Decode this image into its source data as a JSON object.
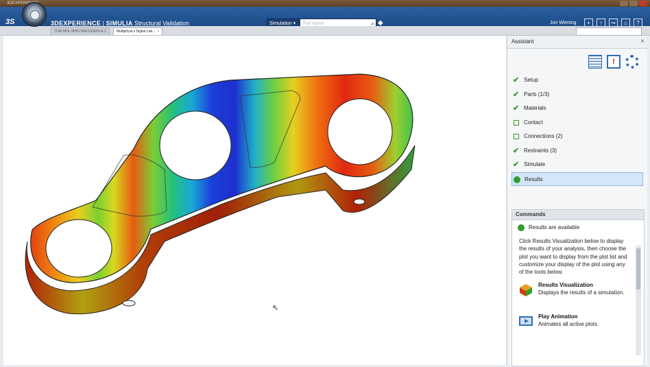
{
  "os": {
    "title": "3DEXPERIENCE"
  },
  "header": {
    "brand": "3DEXPERIENCE",
    "separator": " | ",
    "app_name": "SIMULIA",
    "app_sub": " Structural Validation",
    "search_scope": "Simulation ▾",
    "search_placeholder": "Full name",
    "search_icon": "⌕",
    "tag_icon": "◆",
    "user": "Jon Wiening",
    "buttons": [
      "+",
      "↑",
      "↪",
      "⌂",
      "?"
    ]
  },
  "tabs": [
    {
      "label": "TDIP-MHL-MHO-SIM-SSSRH-A.1"
    },
    {
      "label": "Multiphysics Digital Lab...",
      "close": "×"
    }
  ],
  "viewport": {
    "cursor": "⇖"
  },
  "assistant": {
    "title": "Assistant",
    "close": "×",
    "tool_alert": "!",
    "steps": [
      {
        "label": "Setup",
        "status": "done",
        "check": "✔"
      },
      {
        "label": "Parts (1/3)",
        "status": "done",
        "check": "✔"
      },
      {
        "label": "Materials",
        "status": "done",
        "check": "✔"
      },
      {
        "label": "Contact",
        "status": "open"
      },
      {
        "label": "Connections (2)",
        "status": "open"
      },
      {
        "label": "Restraints (3)",
        "status": "done",
        "check": "✔"
      },
      {
        "label": "Simulate",
        "status": "done",
        "check": "✔"
      },
      {
        "label": "Results",
        "status": "current"
      }
    ],
    "commands": {
      "title": "Commands",
      "status": "Results are available",
      "description": "Click Results Visualization below to display the results of your analysis, then choose the plot you want to display from the plot list and customize your display of the plot using any of the tools below.",
      "items": [
        {
          "title": "Results Visualization",
          "desc": "Displays the results of a simulation.",
          "icon": "results-visualization-icon"
        },
        {
          "title": "Play Animation",
          "desc": "Animates all active plots.",
          "icon": "play-animation-icon"
        }
      ]
    }
  }
}
